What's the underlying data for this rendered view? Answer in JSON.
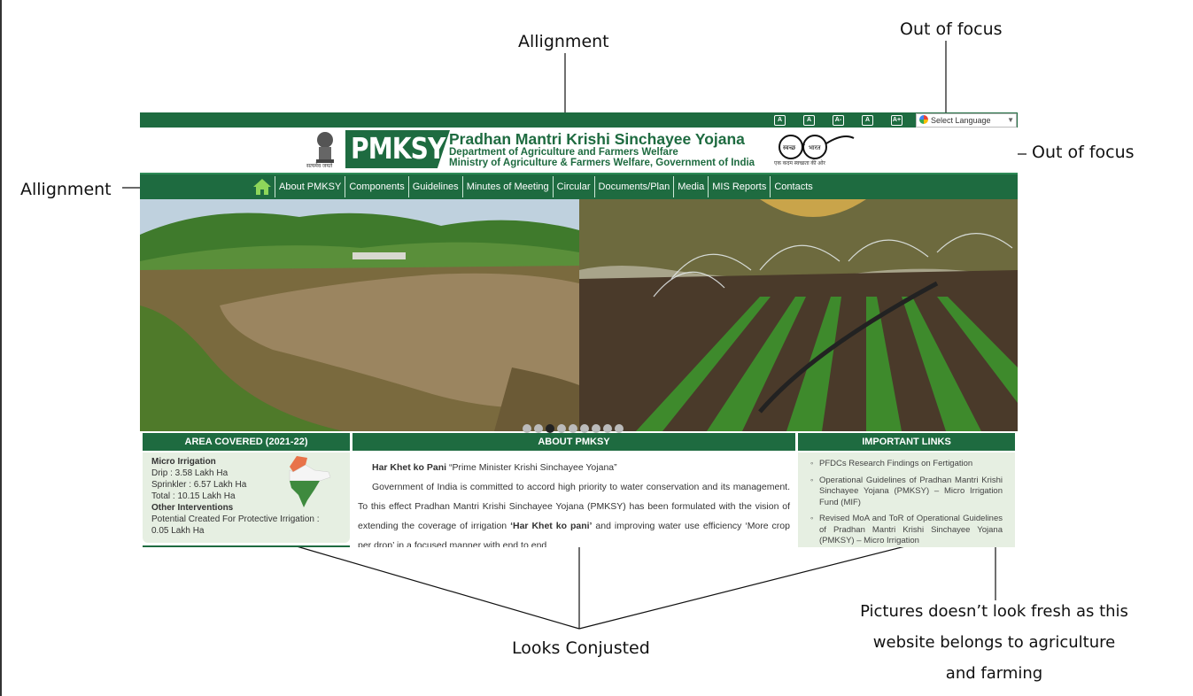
{
  "annotations": {
    "alignment_top": "Allignment",
    "alignment_left": "Allignment",
    "out_of_focus_top": "Out of focus",
    "out_of_focus_right": "Out of focus",
    "conjusted": "Looks Conjusted",
    "pictures_line1": "Pictures doesn’t look fresh as this",
    "pictures_line2": "website belongs to agriculture",
    "pictures_line3": "and farming"
  },
  "site": {
    "colors": {
      "primary_green": "#1e6b40",
      "panel_bg": "#e6efe2"
    },
    "topbar": {
      "font_buttons": [
        "A",
        "A",
        "A-",
        "A",
        "A+"
      ],
      "language_label": "Select Language"
    },
    "header": {
      "logo": "PMKSY",
      "title": "Pradhan Mantri Krishi Sinchayee Yojana",
      "subtitle1": "Department of Agriculture  and Farmers Welfare",
      "subtitle2": "Ministry of Agriculture & Farmers Welfare, Government of India",
      "emblem_caption": "सत्यमेव जयते",
      "swachh_left": "स्वच्छ",
      "swachh_right": "भारत",
      "swachh_caption": "एक कदम स्वच्छता की ओर"
    },
    "nav": {
      "items": [
        "About PMKSY",
        "Components",
        "Guidelines",
        "Minutes of Meeting",
        "Circular",
        "Documents/Plan",
        "Media",
        "MIS Reports",
        "Contacts"
      ]
    },
    "carousel": {
      "slide_count": 9,
      "active_index": 2
    },
    "area_covered": {
      "heading": "AREA COVERED (2021-22)",
      "micro_title": "Micro Irrigation",
      "drip": "Drip : 3.58 Lakh Ha",
      "sprinkler": "Sprinkler : 6.57 Lakh Ha",
      "total": "Total : 10.15 Lakh Ha",
      "other_title": "Other Interventions",
      "potential1": "Potential Created For Protective Irrigation :",
      "potential2": "0.05 Lakh Ha"
    },
    "about": {
      "heading": "ABOUT PMKSY",
      "line1_bold": "Har Khet ko Pani",
      "line1_rest": " “Prime Minister Krishi Sinchayee Yojana”",
      "para_start": "Government of India is committed to accord high priority to water conservation and its management. To this effect Pradhan Mantri Krishi Sinchayee Yojana (PMKSY) has been formulated with the vision of extending the coverage of irrigation ",
      "para_bold": "‘Har Khet ko pani’",
      "para_end": " and improving water use efficiency ‘More crop per drop’ in a focused manner with end to end"
    },
    "important_links": {
      "heading": "IMPORTANT LINKS",
      "items": [
        "PFDCs Research Findings on Fertigation",
        "Operational Guidelines of Pradhan Mantri Krishi Sinchayee Yojana (PMKSY) – Micro Irrigation Fund (MIF)",
        "Revised MoA and ToR of Operational Guidelines of Pradhan Mantri Krishi Sinchayee Yojana (PMKSY) – Micro Irrigation"
      ]
    }
  }
}
